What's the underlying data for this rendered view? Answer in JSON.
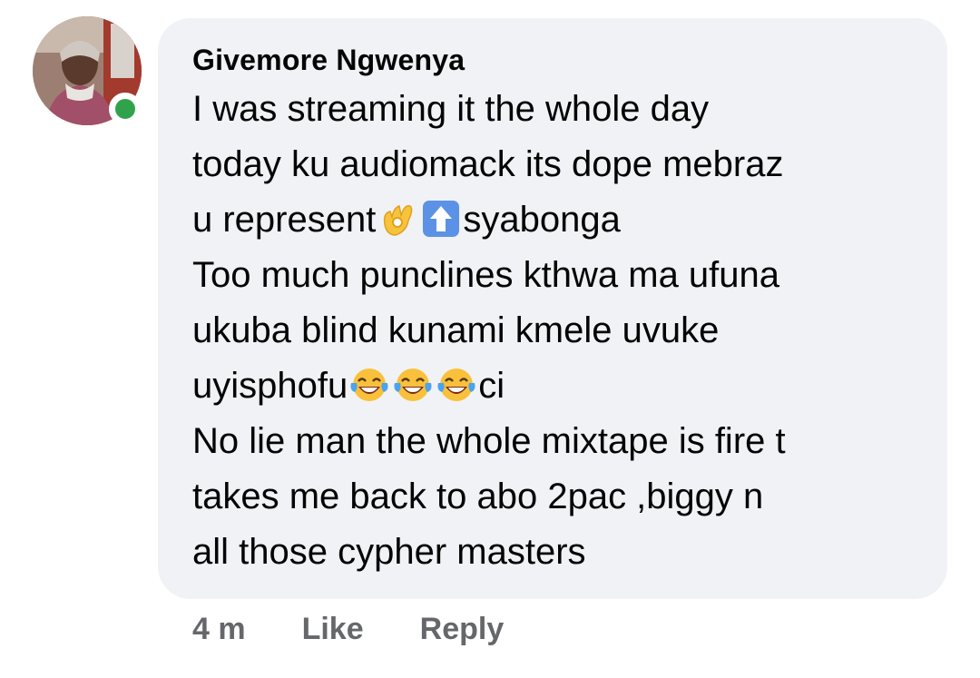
{
  "comment": {
    "author": "Givemore Ngwenya",
    "lines": [
      {
        "text_before": "I was streaming it the whole day",
        "emojis": [],
        "text_after": ""
      },
      {
        "text_before": "today ku audiomack its dope mebraz",
        "emojis": [],
        "text_after": ""
      },
      {
        "text_before": "u represent",
        "emojis": [
          "ok-hand-emoji",
          "up-arrow-emoji"
        ],
        "text_after": "syabonga"
      },
      {
        "text_before": "Too much punclines kthwa ma ufuna",
        "emojis": [],
        "text_after": ""
      },
      {
        "text_before": "ukuba blind kunami kmele uvuke",
        "emojis": [],
        "text_after": ""
      },
      {
        "text_before": "uyisphofu",
        "emojis": [
          "tears-of-joy-emoji",
          "tears-of-joy-emoji",
          "tears-of-joy-emoji"
        ],
        "text_after": "ci"
      },
      {
        "text_before": "No lie man the whole mixtape is fire t",
        "emojis": [],
        "text_after": ""
      },
      {
        "text_before": "takes me back to abo 2pac ,biggy n",
        "emojis": [],
        "text_after": ""
      },
      {
        "text_before": "all those cypher masters",
        "emojis": [],
        "text_after": ""
      }
    ],
    "online": true
  },
  "actions": {
    "time": "4 m",
    "like_label": "Like",
    "reply_label": "Reply"
  },
  "colors": {
    "bubble": "#f0f2f5",
    "text": "#050505",
    "meta": "#65676b",
    "online": "#31a24c"
  }
}
